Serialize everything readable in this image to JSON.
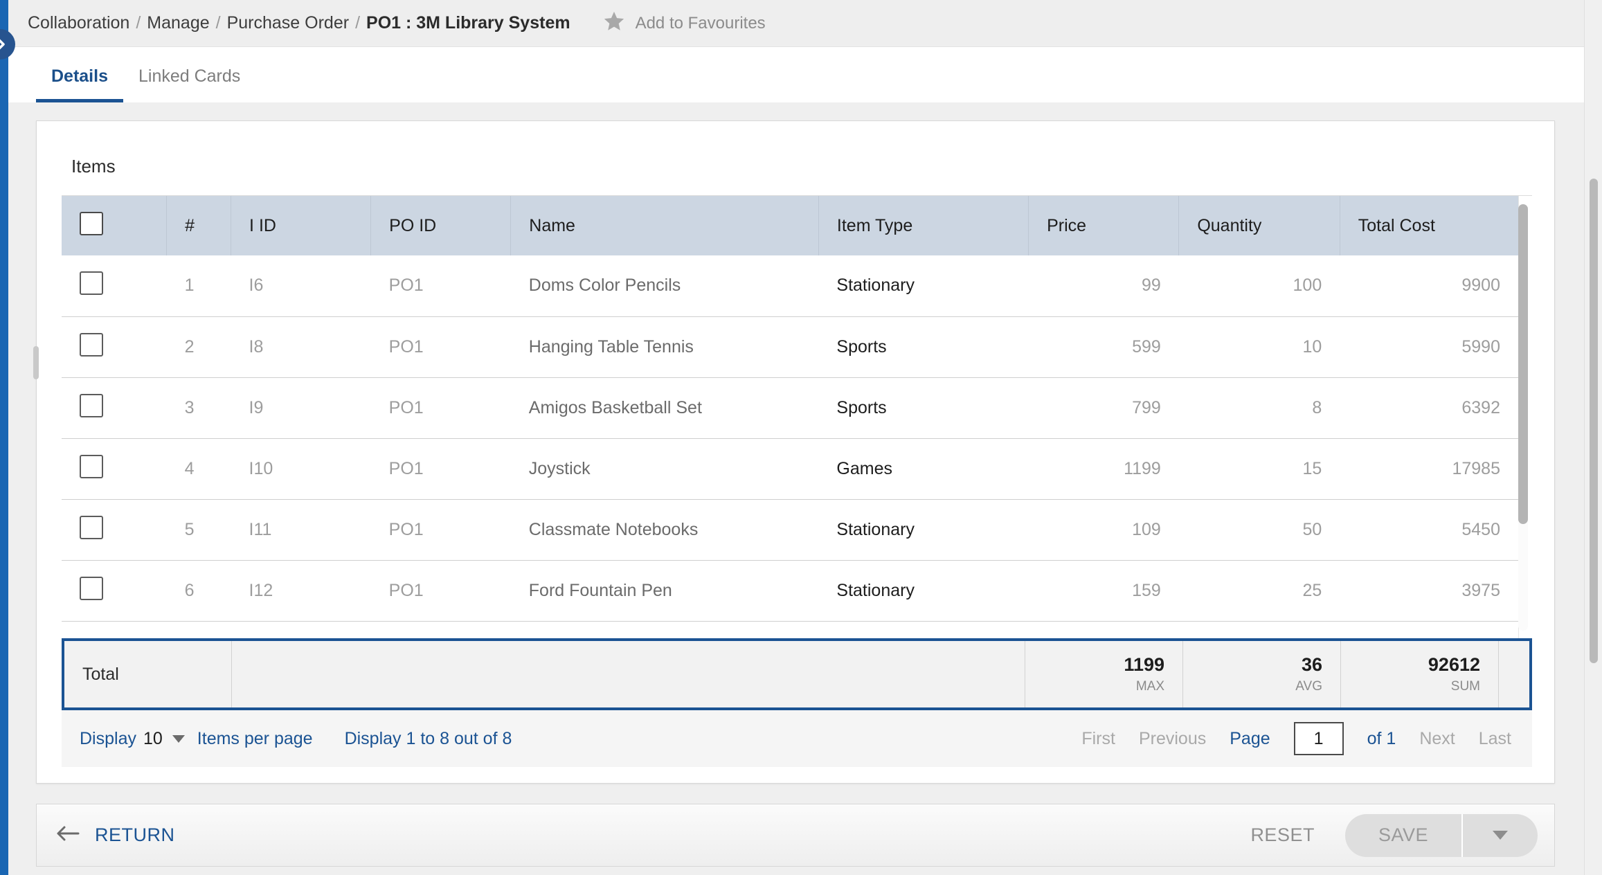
{
  "rail": {
    "expand_icon": "chevron-right-icon"
  },
  "breadcrumb": {
    "items": [
      "Collaboration",
      "Manage",
      "Purchase Order"
    ],
    "separator": "/",
    "current": "PO1 : 3M Library System",
    "favourites_label": "Add to Favourites",
    "favourites_icon": "star-icon"
  },
  "tabs": [
    {
      "label": "Details",
      "active": true
    },
    {
      "label": "Linked Cards",
      "active": false
    }
  ],
  "card": {
    "heading": "Items"
  },
  "table": {
    "select_all_icon": "checkbox-icon",
    "columns": [
      {
        "key": "select",
        "label": ""
      },
      {
        "key": "num",
        "label": "#"
      },
      {
        "key": "iid",
        "label": "I ID"
      },
      {
        "key": "poid",
        "label": "PO ID"
      },
      {
        "key": "name",
        "label": "Name"
      },
      {
        "key": "type",
        "label": "Item Type"
      },
      {
        "key": "price",
        "label": "Price"
      },
      {
        "key": "qty",
        "label": "Quantity"
      },
      {
        "key": "total",
        "label": "Total Cost"
      }
    ],
    "rows": [
      {
        "num": "1",
        "iid": "I6",
        "poid": "PO1",
        "name": "Doms Color Pencils",
        "type": "Stationary",
        "price": "99",
        "qty": "100",
        "total": "9900"
      },
      {
        "num": "2",
        "iid": "I8",
        "poid": "PO1",
        "name": "Hanging Table Tennis",
        "type": "Sports",
        "price": "599",
        "qty": "10",
        "total": "5990"
      },
      {
        "num": "3",
        "iid": "I9",
        "poid": "PO1",
        "name": "Amigos Basketball Set",
        "type": "Sports",
        "price": "799",
        "qty": "8",
        "total": "6392"
      },
      {
        "num": "4",
        "iid": "I10",
        "poid": "PO1",
        "name": "Joystick",
        "type": "Games",
        "price": "1199",
        "qty": "15",
        "total": "17985"
      },
      {
        "num": "5",
        "iid": "I11",
        "poid": "PO1",
        "name": "Classmate Notebooks",
        "type": "Stationary",
        "price": "109",
        "qty": "50",
        "total": "5450"
      },
      {
        "num": "6",
        "iid": "I12",
        "poid": "PO1",
        "name": "Ford Fountain Pen",
        "type": "Stationary",
        "price": "159",
        "qty": "25",
        "total": "3975"
      }
    ],
    "totals": {
      "label": "Total",
      "price": {
        "value": "1199",
        "agg": "MAX"
      },
      "quantity": {
        "value": "36",
        "agg": "AVG"
      },
      "total": {
        "value": "92612",
        "agg": "SUM"
      }
    }
  },
  "pagination": {
    "display_label": "Display",
    "page_size": "10",
    "items_per_page_label": "Items per page",
    "range_label": "Display 1 to 8 out of 8",
    "first": "First",
    "previous": "Previous",
    "page_label": "Page",
    "page_value": "1",
    "of_label": "of 1",
    "next": "Next",
    "last": "Last"
  },
  "actions": {
    "return_label": "RETURN",
    "return_icon": "arrow-left-icon",
    "reset_label": "RESET",
    "save_label": "SAVE",
    "save_menu_icon": "caret-down-icon"
  },
  "colors": {
    "accent": "#1b5393",
    "header_bg": "#ccd6e2",
    "rail": "#1a66b3",
    "page_bg": "#efefef"
  }
}
